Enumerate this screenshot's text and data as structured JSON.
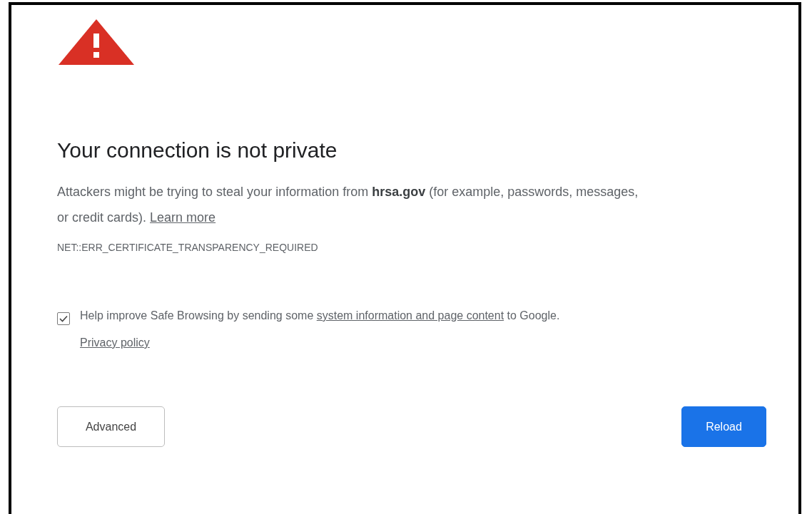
{
  "heading": "Your connection is not private",
  "description": {
    "text": "Attackers might be trying to steal your information from **hrsa.gov** (for example, passwords, messages, or credit cards).",
    "link": "Learn more"
  },
  "error_code": "NET::ERR_CERTIFICATE_TRANSPARENCY_REQUIRED",
  "safe_browsing": {
    "checked": true,
    "text_before": "Help improve Safe Browsing by sending some",
    "link": "system information and page content",
    "text_after": "to Google.",
    "privacy_link": "Privacy policy"
  },
  "buttons": [
    {
      "kind": "secondary",
      "label": "Advanced"
    },
    {
      "kind": "primary",
      "label": "Reload"
    }
  ]
}
